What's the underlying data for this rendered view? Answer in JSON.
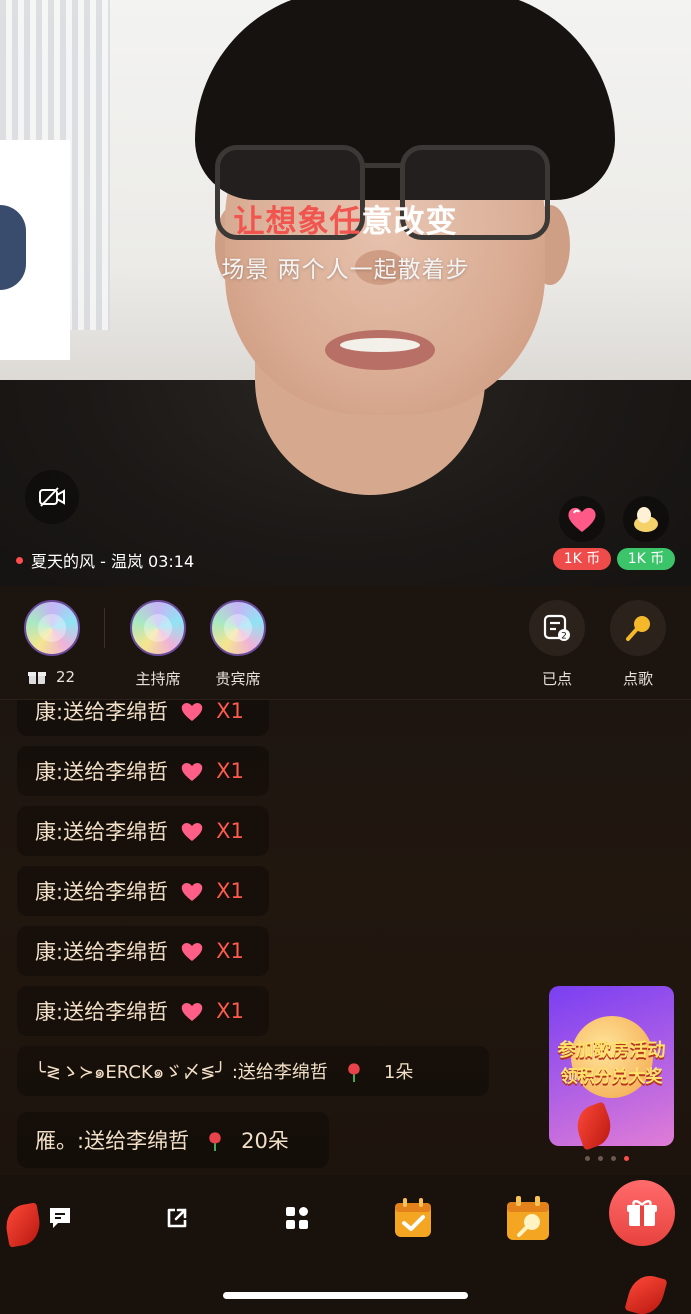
{
  "video": {
    "overlay_prefix": "让想象任",
    "overlay_suffix": "意改变",
    "overlay_sub": "场景 两个人一起散着步",
    "now_playing": "夏天的风 - 温岚 03:14",
    "coin_left": "1K 币",
    "coin_right": "1K 币"
  },
  "seats": {
    "gift_count": "22",
    "host_label": "主持席",
    "vip_label": "贵宾席",
    "ordered_label": "已点",
    "ordered_badge": "2",
    "request_label": "点歌"
  },
  "chat": {
    "messages": [
      {
        "text": "康:送给李绵哲",
        "count": "X1"
      },
      {
        "text": "康:送给李绵哲",
        "count": "X1"
      },
      {
        "text": "康:送给李绵哲",
        "count": "X1"
      },
      {
        "text": "康:送给李绵哲",
        "count": "X1"
      },
      {
        "text": "康:送给李绵哲",
        "count": "X1"
      },
      {
        "text": "康:送给李绵哲",
        "count": "X1"
      },
      {
        "text": "╰≷ゝ≻๑ERCK๑ゞ〆≶╯ :送给李绵哲",
        "count": "1朵"
      },
      {
        "text": "雁。:送给李绵哲",
        "count": "20朵"
      }
    ]
  },
  "banner": {
    "line1": "参加歌房活动",
    "line2": "领积分兑大奖"
  },
  "colors": {
    "accent_red": "#ff4d4d",
    "coin_left_bg": "#f04b4b",
    "coin_right_bg": "#3cc46a",
    "chat_text": "#f2dfc7"
  }
}
